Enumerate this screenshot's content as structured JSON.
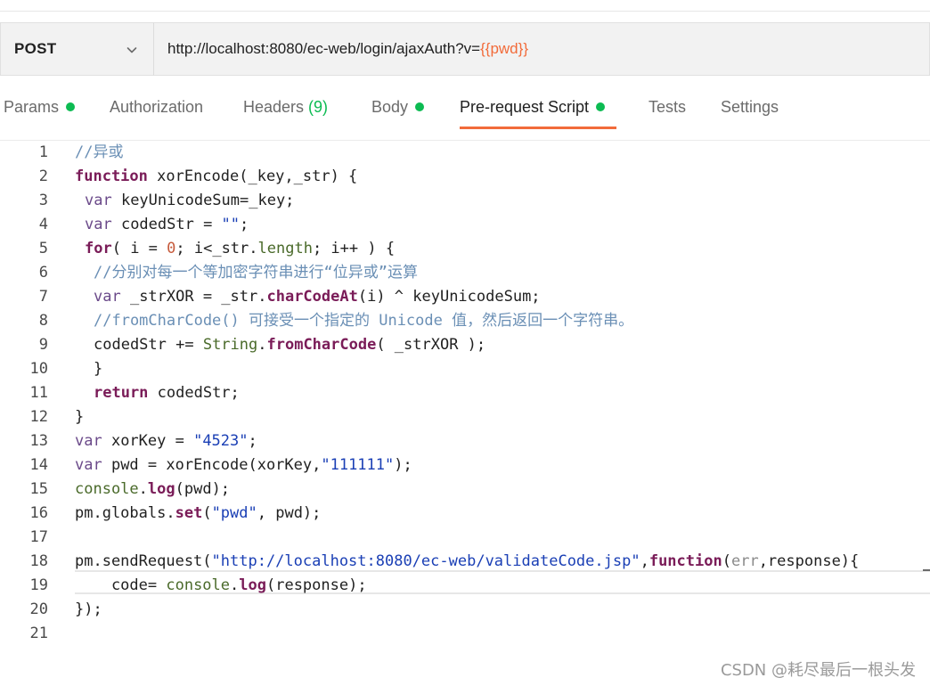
{
  "request": {
    "method": "POST",
    "url_prefix": "http://localhost:8080/ec-web/login/ajaxAuth?v=",
    "url_variable": "{{pwd}}"
  },
  "tabs": [
    {
      "label": "Params",
      "dot": true
    },
    {
      "label": "Authorization"
    },
    {
      "label": "Headers",
      "count": "(9)"
    },
    {
      "label": "Body",
      "dot": true
    },
    {
      "label": "Pre-request Script",
      "dot": true,
      "active": true
    },
    {
      "label": "Tests"
    },
    {
      "label": "Settings"
    }
  ],
  "editor": {
    "lines": [
      "1",
      "2",
      "3",
      "4",
      "5",
      "6",
      "7",
      "8",
      "9",
      "10",
      "11",
      "12",
      "13",
      "14",
      "15",
      "16",
      "17",
      "18",
      "19",
      "20",
      "21"
    ],
    "code": {
      "l1": "//异或",
      "l2_kw": "function",
      "l2_rest": " xorEncode(_key,_str) {",
      "l3_kw": "var",
      "l3_rest": " keyUnicodeSum=_key;",
      "l4_kw": "var",
      "l4_mid": " codedStr = ",
      "l4_str": "\"\"",
      "l4_end": ";",
      "l5_kw": "for",
      "l5_a": "( i = ",
      "l5_num": "0",
      "l5_b": "; i<_str.",
      "l5_prop": "length",
      "l5_c": "; i++ ) {",
      "l6": "//分别对每一个等加密字符串进行“位异或”运算",
      "l7_kw": "var",
      "l7_a": " _strXOR = _str.",
      "l7_fn": "charCodeAt",
      "l7_b": "(i) ^ keyUnicodeSum;",
      "l8": "//fromCharCode() 可接受一个指定的 Unicode 值，然后返回一个字符串。",
      "l9_a": "codedStr += ",
      "l9_obj": "String",
      "l9_dot": ".",
      "l9_fn": "fromCharCode",
      "l9_b": "( _strXOR );",
      "l10": "}",
      "l11_kw": "return",
      "l11_rest": " codedStr;",
      "l12": "}",
      "l13_kw": "var",
      "l13_mid": " xorKey = ",
      "l13_str": "\"4523\"",
      "l13_end": ";",
      "l14_kw": "var",
      "l14_mid": " pwd = xorEncode(xorKey,",
      "l14_str": "\"111111\"",
      "l14_end": ");",
      "l15_obj": "console",
      "l15_dot": ".",
      "l15_fn": "log",
      "l15_rest": "(pwd);",
      "l16_a": "pm.globals.",
      "l16_fn": "set",
      "l16_b": "(",
      "l16_str": "\"pwd\"",
      "l16_c": ", pwd);",
      "l18_a": "pm.sendRequest(",
      "l18_str": "\"http://localhost:8080/ec-web/validateCode.jsp\"",
      "l18_b": ",",
      "l18_kw": "function",
      "l18_c": "(",
      "l18_param": "err",
      "l18_d": ",response){",
      "l19_a": "    code= ",
      "l19_obj": "console",
      "l19_dot": ".",
      "l19_fn": "log",
      "l19_b": "(response);",
      "l20": "});"
    }
  },
  "watermark": "CSDN @耗尽最后一根头发",
  "colors": {
    "accent": "#f26b3a",
    "status_dot": "#0cbb52"
  }
}
